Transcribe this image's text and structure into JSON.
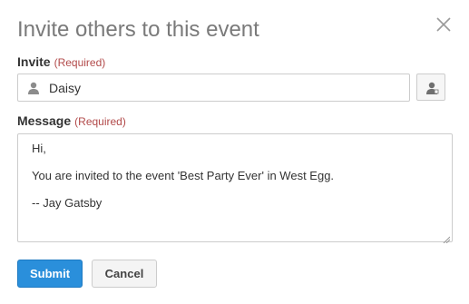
{
  "dialog": {
    "title": "Invite others to this event",
    "close_icon": "close-icon"
  },
  "invite": {
    "label": "Invite",
    "required": "(Required)",
    "value": "Daisy",
    "person_icon": "person-icon",
    "contacts_icon": "contacts-icon"
  },
  "message": {
    "label": "Message",
    "required": "(Required)",
    "lines": [
      "Hi,",
      "You are invited to the event 'Best Party Ever' in West Egg.",
      "-- Jay Gatsby"
    ]
  },
  "buttons": {
    "submit": "Submit",
    "cancel": "Cancel"
  },
  "colors": {
    "primary": "#2a8fdb",
    "required": "#b24a4a",
    "title": "#7a7a7a"
  }
}
